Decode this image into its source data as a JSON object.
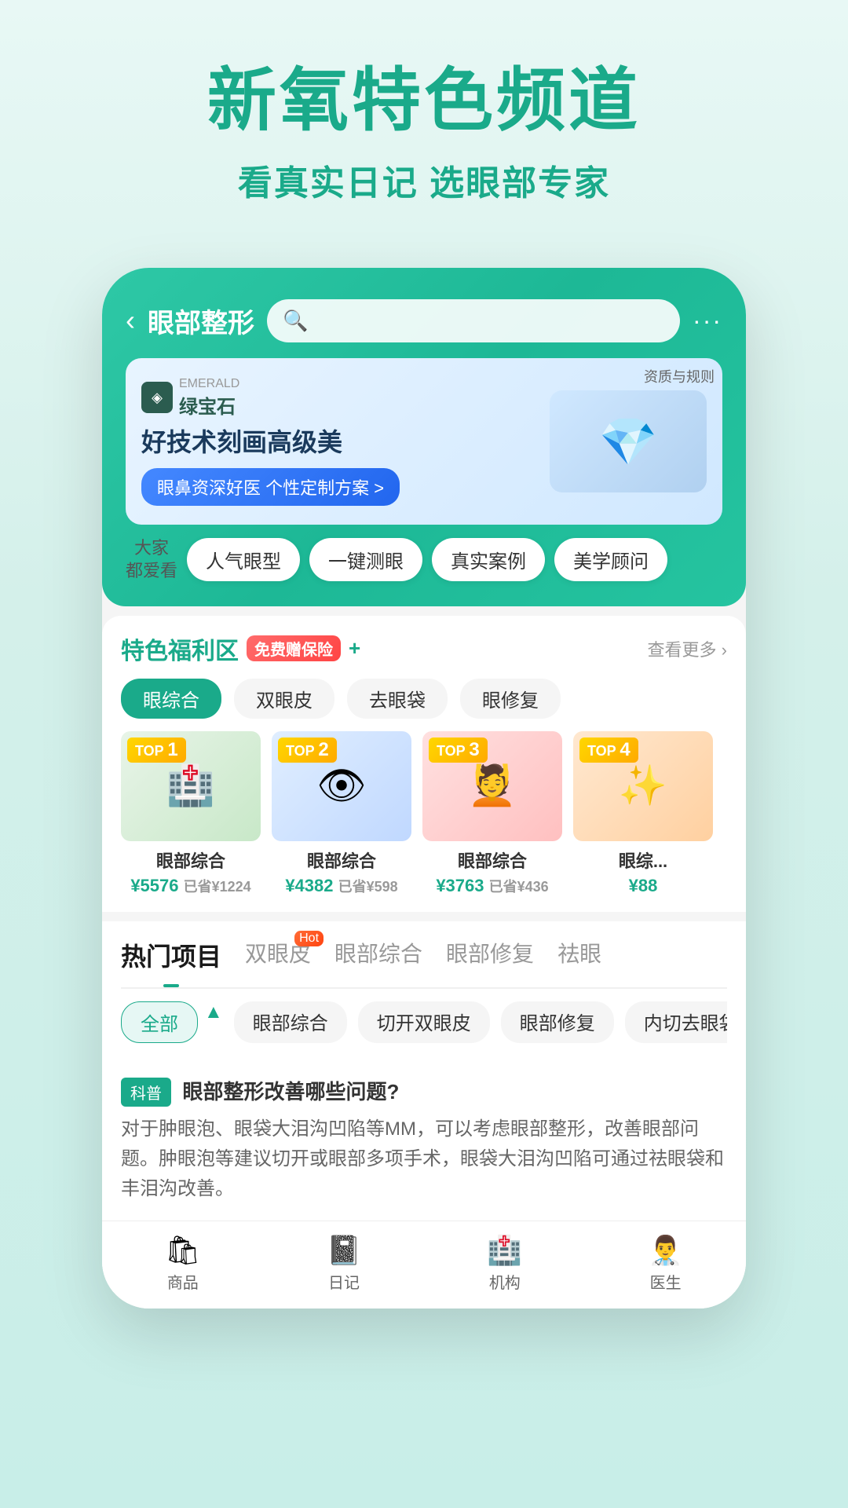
{
  "hero": {
    "title": "新氧特色频道",
    "subtitle": "看真实日记 选眼部专家"
  },
  "app": {
    "back_label": "‹",
    "nav_title": "眼部整形",
    "search_placeholder": "",
    "more_label": "···"
  },
  "banner": {
    "brand_icon": "◈",
    "brand_name_small": "EMERALD",
    "brand_name": "绿宝石",
    "title": "好技术刻画高级美",
    "btn_text": "眼鼻资深好医 个性定制方案 >",
    "tag": "资质与规则",
    "image_icon": "💎"
  },
  "quick_tags": {
    "label": "大家\n都爱看",
    "items": [
      "人气眼型",
      "一键测眼",
      "真实案例",
      "美学顾问"
    ]
  },
  "benefit_section": {
    "title": "特色福利区",
    "free_tag": "免费赠保险",
    "plus": "+",
    "more": "查看更多 ›"
  },
  "categories": [
    "眼综合",
    "双眼皮",
    "去眼袋",
    "眼修复"
  ],
  "products": [
    {
      "top_label": "TOP",
      "top_num": "1",
      "name": "眼部综合",
      "price": "¥5576",
      "save": "已省¥1224",
      "bg": "card-bg-1",
      "icon": "🏥"
    },
    {
      "top_label": "TOP",
      "top_num": "2",
      "name": "眼部综合",
      "price": "¥4382",
      "save": "已省¥598",
      "bg": "card-bg-2",
      "icon": "👁"
    },
    {
      "top_label": "TOP",
      "top_num": "3",
      "name": "眼部综合",
      "price": "¥3763",
      "save": "已省¥436",
      "bg": "card-bg-3",
      "icon": "💆"
    },
    {
      "top_label": "TOP",
      "top_num": "4",
      "name": "眼综...",
      "price": "¥88",
      "save": "",
      "bg": "card-bg-4",
      "icon": "✨"
    }
  ],
  "hot_section": {
    "tabs": [
      {
        "label": "热门项目",
        "active": true
      },
      {
        "label": "双眼皮",
        "active": false,
        "badge": "Hot"
      },
      {
        "label": "眼部综合",
        "active": false
      },
      {
        "label": "眼部修复",
        "active": false
      },
      {
        "label": "祛眼",
        "active": false
      }
    ]
  },
  "filter_chips": [
    {
      "label": "全部",
      "active": true
    },
    {
      "label": "眼部综合",
      "active": false
    },
    {
      "label": "切开双眼皮",
      "active": false
    },
    {
      "label": "眼部修复",
      "active": false
    },
    {
      "label": "内切去眼袋",
      "active": false
    }
  ],
  "article": {
    "tag": "科普",
    "title": "眼部整形改善哪些问题?",
    "content": "对于肿眼泡、眼袋大泪沟凹陷等MM，可以考虑眼部整形，改善眼部问题。肿眼泡等建议切开或眼部多项手术，眼袋大泪沟凹陷可通过祛眼袋和丰泪沟改善。"
  },
  "bottom_nav": {
    "items": [
      {
        "icon": "🛍",
        "label": "商品"
      },
      {
        "icon": "📓",
        "label": "日记"
      },
      {
        "icon": "🏥",
        "label": "机构"
      },
      {
        "icon": "👨‍⚕️",
        "label": "医生"
      }
    ]
  }
}
